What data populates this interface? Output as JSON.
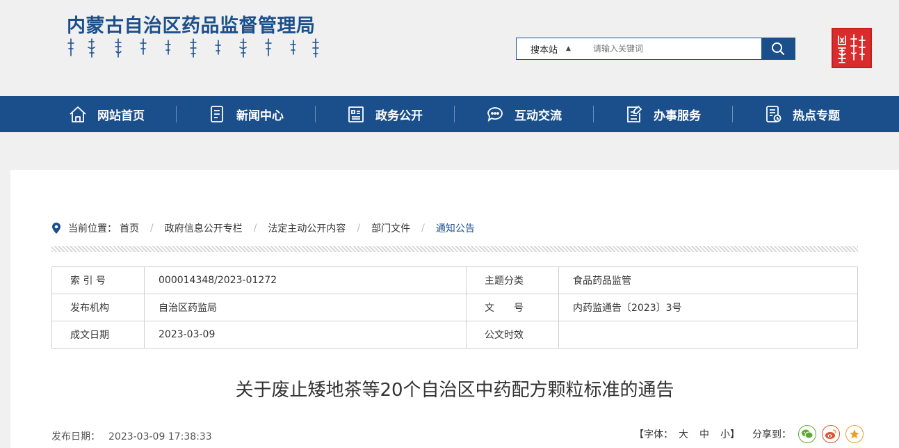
{
  "header": {
    "site_title": "内蒙古自治区药品监督管理局",
    "search": {
      "scope": "搜本站",
      "placeholder": "请输入关键词"
    }
  },
  "nav": {
    "items": [
      {
        "label": "网站首页",
        "icon": "home-icon"
      },
      {
        "label": "新闻中心",
        "icon": "news-icon"
      },
      {
        "label": "政务公开",
        "icon": "document-icon"
      },
      {
        "label": "互动交流",
        "icon": "chat-icon"
      },
      {
        "label": "办事服务",
        "icon": "edit-icon"
      },
      {
        "label": "热点专题",
        "icon": "topic-icon"
      }
    ]
  },
  "breadcrumb": {
    "prefix": "当前位置：",
    "items": [
      "首页",
      "政府信息公开专栏",
      "法定主动公开内容",
      "部门文件",
      "通知公告"
    ]
  },
  "meta": {
    "index_label": "索 引 号",
    "index_value": "000014348/2023-01272",
    "category_label": "主题分类",
    "category_value": "食品药品监管",
    "org_label": "发布机构",
    "org_value": "自治区药监局",
    "docno_label": "文　　号",
    "docno_value": "内药监通告〔2023〕3号",
    "date_label": "成文日期",
    "date_value": "2023-03-09",
    "validity_label": "公文时效",
    "validity_value": ""
  },
  "article": {
    "title": "关于废止矮地茶等20个自治区中药配方颗粒标准的通告",
    "publish_label": "发布日期：",
    "publish_value": "2023-03-09 17:38:33"
  },
  "tools": {
    "font_label": "【字体：",
    "font_large": "大",
    "font_medium": "中",
    "font_small": "小】",
    "share_label": "分享到："
  },
  "colors": {
    "brand": "#1b4f8c",
    "seal": "#d92d2d",
    "wechat": "#5aaa2e",
    "weibo": "#e2512c",
    "favorite": "#e8a02a"
  }
}
